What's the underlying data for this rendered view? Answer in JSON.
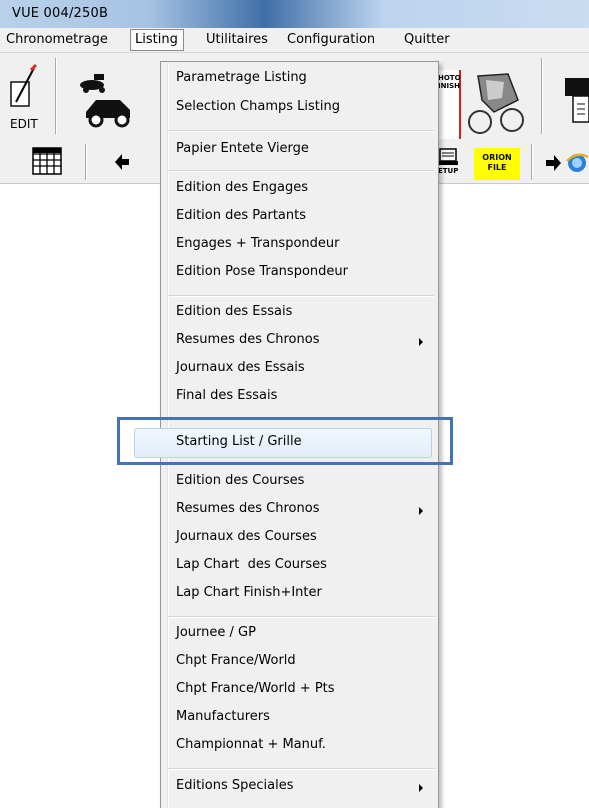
{
  "window": {
    "title": "VUE  004/250B"
  },
  "menubar": {
    "items": [
      "Chronometrage",
      "Listing",
      "Utilitaires",
      "Configuration",
      "Quitter"
    ],
    "active": "Listing"
  },
  "toolbar": {
    "edit_label": "EDIT",
    "photo_finish_label": "HOTO\nINISH",
    "setup_label": "ETUP",
    "orion_label": "ORION\nFILE",
    "orion_color": "#ffff00"
  },
  "listing_menu": {
    "items": [
      "Parametrage Listing",
      "Selection Champs Listing",
      "Papier Entete Vierge",
      "Edition des Engages",
      "Edition des Partants",
      "Engages + Transpondeur",
      "Edition Pose Transpondeur",
      "Edition des Essais",
      "Resumes des Chronos",
      "Journaux des Essais",
      "Final des Essais",
      "Starting List / Grille",
      "Edition des Courses",
      "Resumes des Chronos",
      "Journaux des Courses",
      "Lap Chart  des Courses",
      "Lap Chart Finish+Inter",
      "Journee / GP",
      "Chpt France/World",
      "Chpt France/World + Pts",
      "Manufacturers",
      "Championnat + Manuf.",
      "Editions Speciales"
    ],
    "highlighted": "Starting List / Grille",
    "highlight_color": "#4474b4"
  }
}
